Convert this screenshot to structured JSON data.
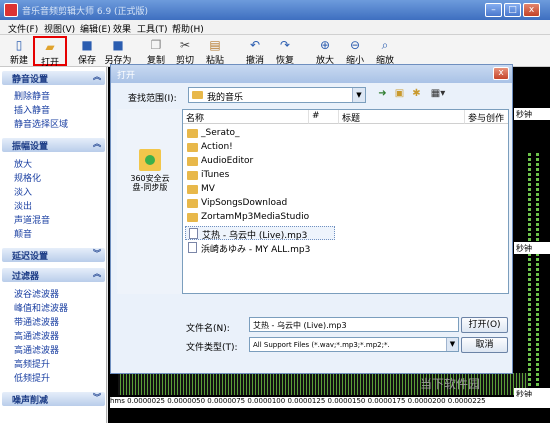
{
  "app": {
    "title": "音乐音频剪辑大师 6.9 (正式版)",
    "win_min": "–",
    "win_max": "□",
    "win_close": "x"
  },
  "menu": [
    "文件(F)",
    "视图(V)",
    "编辑(E)",
    "效果",
    "工具(T)",
    "帮助(H)"
  ],
  "toolbar": [
    {
      "label": "新建",
      "icon": "new-icon"
    },
    {
      "label": "打开",
      "icon": "open-folder-icon"
    },
    {
      "label": "保存",
      "icon": "save-icon"
    },
    {
      "label": "另存为",
      "icon": "save-as-icon"
    },
    {
      "label": "复制",
      "icon": "copy-icon"
    },
    {
      "label": "剪切",
      "icon": "cut-icon"
    },
    {
      "label": "粘贴",
      "icon": "paste-icon"
    },
    {
      "label": "撤消",
      "icon": "undo-icon"
    },
    {
      "label": "恢复",
      "icon": "redo-icon"
    },
    {
      "label": "放大",
      "icon": "zoom-in-icon"
    },
    {
      "label": "缩小",
      "icon": "zoom-out-icon"
    },
    {
      "label": "缩放",
      "icon": "zoom-icon"
    }
  ],
  "sidebar": {
    "sections": [
      {
        "title": "静音设置",
        "items": [
          "删除静音",
          "插入静音",
          "静音选择区域"
        ]
      },
      {
        "title": "振幅设置",
        "items": [
          "放大",
          "规格化",
          "淡入",
          "淡出",
          "声道混音",
          "颠音"
        ]
      },
      {
        "title": "延迟设置",
        "items": []
      },
      {
        "title": "过滤器",
        "items": [
          "波谷滤波器",
          "峰值和滤波器",
          "带通滤波器",
          "高通滤波器",
          "高通滤波器",
          "高频提升",
          "低频提升"
        ]
      },
      {
        "title": "噪声削减",
        "items": []
      }
    ]
  },
  "right_panel": {
    "labels": [
      "秒钟",
      "秒钟",
      "秒钟"
    ]
  },
  "ruler": {
    "text": "hms   0.0000025  0.0000050  0.0000075  0.0000100  0.0000125  0.0000150  0.0000175  0.0000200  0.0000225"
  },
  "watermark": "当下软件园",
  "dialog": {
    "title": "打开",
    "close": "x",
    "lookin_label": "查找范围(I):",
    "lookin_value": "我的音乐",
    "place": "360安全云盘-同步版",
    "columns": [
      "名称",
      "#",
      "标题",
      "参与创作"
    ],
    "files": [
      {
        "name": "_Serato_",
        "type": "folder"
      },
      {
        "name": "Action!",
        "type": "folder"
      },
      {
        "name": "AudioEditor",
        "type": "folder"
      },
      {
        "name": "iTunes",
        "type": "folder"
      },
      {
        "name": "MV",
        "type": "folder"
      },
      {
        "name": "VipSongsDownload",
        "type": "folder"
      },
      {
        "name": "ZortamMp3MediaStudio",
        "type": "folder"
      },
      {
        "name": "艾热 - 乌云中 (Live).mp3",
        "type": "mp3",
        "selected": true
      },
      {
        "name": "浜崎あゆみ - MY ALL.mp3",
        "type": "mp3"
      }
    ],
    "filename_label": "文件名(N):",
    "filename_value": "艾热 - 乌云中 (Live).mp3",
    "filetype_label": "文件类型(T):",
    "filetype_value": "All Support Files (*.wav;*.mp3;*.mp2;*.",
    "open_button": "打开(O)",
    "cancel_button": "取消"
  }
}
